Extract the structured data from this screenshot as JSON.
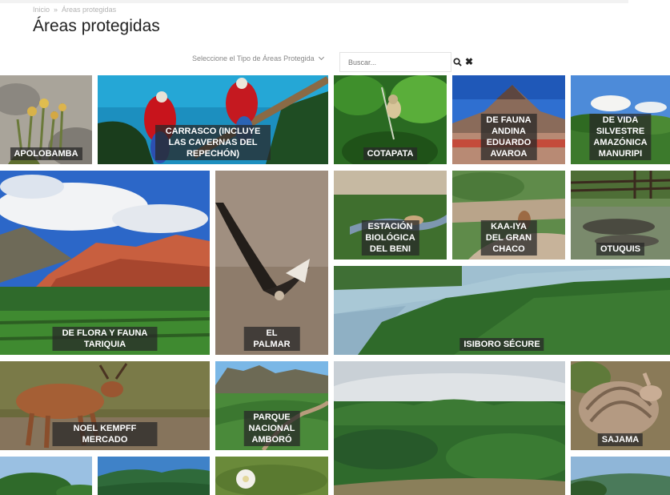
{
  "breadcrumb": {
    "home": "Inicio",
    "separator": "»",
    "current": "Áreas protegidas"
  },
  "page_title": "Áreas protegidas",
  "filter": {
    "label": "Seleccione el Tipo de Áreas Protegida"
  },
  "search": {
    "placeholder": "Buscar..."
  },
  "icons": {
    "search": "search-icon",
    "close": "close-icon"
  },
  "tiles": [
    {
      "label": "APOLOBAMBA"
    },
    {
      "label": "CARRASCO (INCLUYE LAS CAVERNAS DEL\nREPECHÓN)"
    },
    {
      "label": "COTAPATA"
    },
    {
      "label": "DE FAUNA ANDINA\nEDUARDO AVAROA"
    },
    {
      "label": "DE VIDA SILVESTRE\nAMAZÓNICA\nMANURIPI"
    },
    {
      "label": "DE FLORA Y FAUNA TARIQUIA"
    },
    {
      "label": "EL PALMAR"
    },
    {
      "label": "ESTACIÓN BIOLÓGICA\nDEL BENI"
    },
    {
      "label": "KAA-IYA DEL GRAN\nCHACO"
    },
    {
      "label": "OTUQUIS"
    },
    {
      "label": "ISIBORO SÉCURE"
    },
    {
      "label": "NOEL KEMPFF MERCADO"
    },
    {
      "label": "PARQUE NACIONAL\nAMBORÓ"
    },
    {
      "label": "SAJAMA"
    }
  ]
}
